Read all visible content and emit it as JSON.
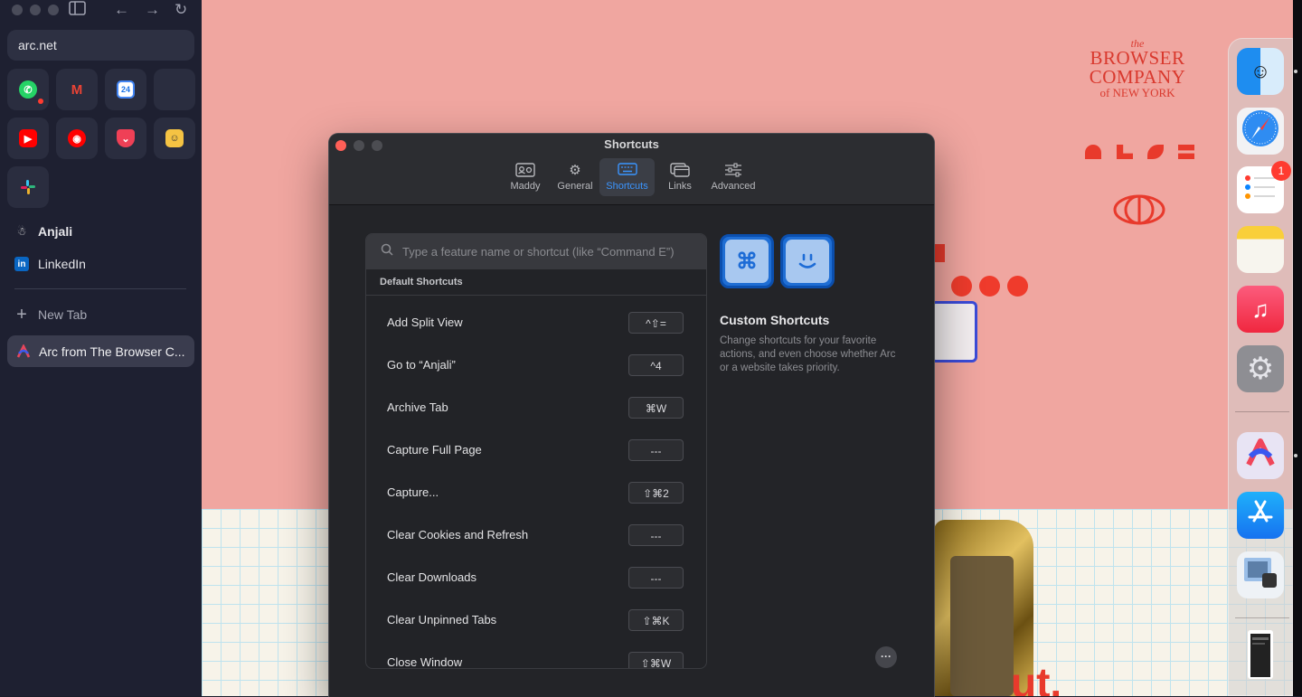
{
  "sidebar": {
    "url": "arc.net",
    "pinned_apps": [
      "WhatsApp",
      "Gmail",
      "Calendar",
      "",
      "YouTube",
      "YouTube Music",
      "Pocket",
      "Bitmoji",
      "Slack"
    ],
    "calendar_day": "24",
    "items": [
      {
        "label": "Anjali"
      },
      {
        "label": "LinkedIn"
      }
    ],
    "new_tab_label": "New Tab",
    "active_tab_label": "Arc from The Browser C..."
  },
  "website": {
    "brand_the": "the",
    "brand_line1": "BROWSER",
    "brand_line2": "COMPANY",
    "brand_line3": "of NEW YORK",
    "big_text": "ut."
  },
  "settings": {
    "title": "Shortcuts",
    "tabs": [
      {
        "label": "Maddy",
        "icon": "profile-card-icon"
      },
      {
        "label": "General",
        "icon": "gear-icon"
      },
      {
        "label": "Shortcuts",
        "icon": "keyboard-icon",
        "active": true
      },
      {
        "label": "Links",
        "icon": "links-window-icon"
      },
      {
        "label": "Advanced",
        "icon": "sliders-icon"
      }
    ],
    "search_placeholder": "Type a feature name or shortcut (like “Command E”)",
    "section_header": "Default Shortcuts",
    "shortcuts": [
      {
        "label": "Add Split View",
        "key": "^⇧="
      },
      {
        "label": "Go to “Anjali”",
        "key": "^4"
      },
      {
        "label": "Archive Tab",
        "key": "⌘W"
      },
      {
        "label": "Capture Full Page",
        "key": "---"
      },
      {
        "label": "Capture...",
        "key": "⇧⌘2"
      },
      {
        "label": "Clear Cookies and Refresh",
        "key": "---"
      },
      {
        "label": "Clear Downloads",
        "key": "---"
      },
      {
        "label": "Clear Unpinned Tabs",
        "key": "⇧⌘K"
      },
      {
        "label": "Close Window",
        "key": "⇧⌘W"
      }
    ],
    "custom_icon_1": "⌘",
    "custom_title": "Custom Shortcuts",
    "custom_desc": "Change shortcuts for your favorite actions, and even choose whether Arc or a website takes priority.",
    "more_label": "···"
  },
  "dock": {
    "apps": [
      "Finder",
      "Safari",
      "Reminders",
      "Notes",
      "Music",
      "System Settings",
      "Arc",
      "App Store",
      "Preview",
      "Documents"
    ],
    "reminders_badge": "1"
  },
  "colors": {
    "accent": "#3b95ff",
    "site_pink": "#f0a6a0",
    "site_red": "#e83a2c",
    "close": "#ff5f57"
  }
}
